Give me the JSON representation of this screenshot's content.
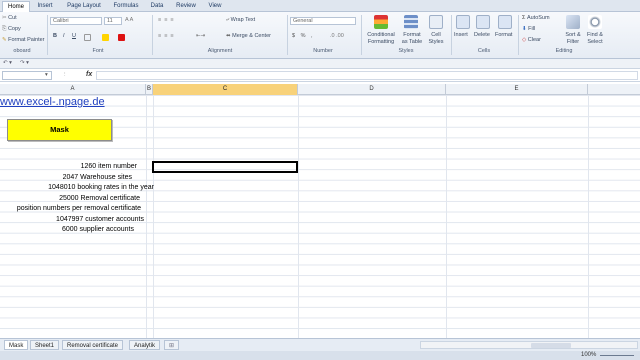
{
  "ribbon_tabs": [
    "Home",
    "Insert",
    "Page Layout",
    "Formulas",
    "Data",
    "Review",
    "View"
  ],
  "clipboard": {
    "cut": "Cut",
    "copy": "Copy",
    "format_painter": "Format Painter",
    "label": "oboard"
  },
  "font": {
    "name": "Calibri",
    "size": "11",
    "label": "Font"
  },
  "alignment": {
    "wrap": "Wrap Text",
    "merge": "Merge & Center",
    "label": "Alignment"
  },
  "number": {
    "format": "General",
    "label": "Number"
  },
  "styles": {
    "conditional": "Conditional\nFormatting",
    "format_table": "Format\nas Table",
    "cell_styles": "Cell\nStyles",
    "label": "Styles"
  },
  "cells": {
    "insert": "Insert",
    "delete": "Delete",
    "format": "Format",
    "label": "Cells"
  },
  "editing": {
    "autosum": "AutoSum",
    "fill": "Fill",
    "clear": "Clear",
    "sort": "Sort &\nFilter",
    "find": "Find &\nSelect",
    "label": "Editing"
  },
  "formula_bar": {
    "fx": "fx",
    "value": ""
  },
  "columns": [
    "A",
    "B",
    "C",
    "D",
    "E"
  ],
  "sheet": {
    "link": "www.excel-.npage.de",
    "mask_button": "Mask",
    "rows": [
      "1260 item number",
      "2047 Warehouse sites",
      "1048010 booking rates in the year",
      "25000 Removal certificate",
      "position numbers per removal certificate",
      "1047997 customer accounts",
      "6000 supplier accounts"
    ]
  },
  "sheet_tabs": [
    "Mask",
    "Sheet1",
    "Removal certificate",
    "Analytik"
  ],
  "zoom": "100%"
}
